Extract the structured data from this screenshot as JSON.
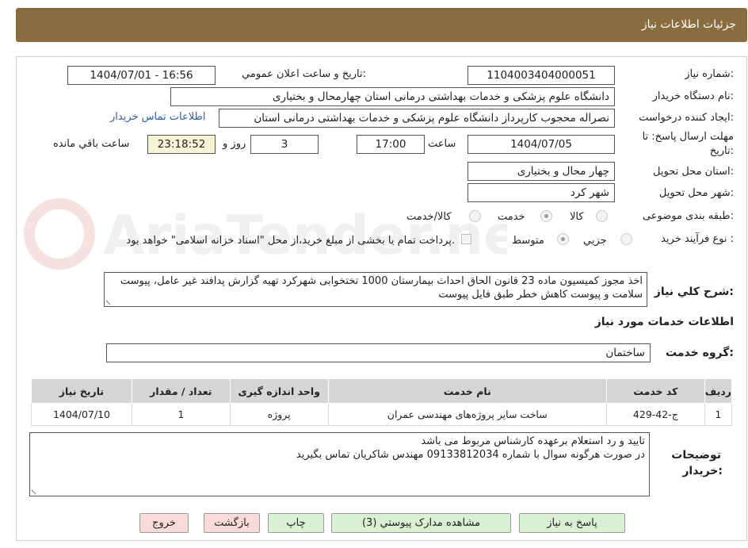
{
  "header": {
    "title": "جزئیات اطلاعات نیاز"
  },
  "watermark": {
    "text": "AriaTender.neT"
  },
  "form": {
    "need_number": {
      "label": "شماره نیاز:",
      "value": "1104003404000051"
    },
    "announce": {
      "label": "تاریخ و ساعت اعلان عمومي:",
      "value": "1404/07/01 - 16:56"
    },
    "buyer_org": {
      "label": "نام دستگاه خریدار:",
      "value": "دانشگاه علوم پزشکی و خدمات بهداشتی درمانی استان چهارمحال و بختیاری"
    },
    "requester": {
      "label": "ایجاد کننده درخواست:",
      "value": "نصراله محجوب کارپرداز دانشگاه علوم پزشکی و خدمات بهداشتی درمانی استان",
      "contact_link": "اطلاعات تماس خریدار"
    },
    "deadline": {
      "label_line1": "مهلت ارسال پاسخ: تا",
      "label_line2": "تاریخ:",
      "date": "1404/07/05",
      "time_label": "ساعت",
      "time": "17:00",
      "days": "3",
      "days_label": "روز و",
      "remaining": "23:18:52",
      "remaining_label": "ساعت باقي مانده"
    },
    "delivery_province": {
      "label": "استان محل تحویل:",
      "value": "چهار محال و بختیاری"
    },
    "delivery_city": {
      "label": "شهر محل تحویل:",
      "value": "شهر کرد"
    },
    "category": {
      "label": "طبقه بندی موضوعی:",
      "options": [
        "کالا",
        "خدمت",
        "کالا/خدمت"
      ],
      "selected": "خدمت"
    },
    "process": {
      "label": "نوع فرآیند خرید :",
      "options": [
        "جزيي",
        "متوسط"
      ],
      "selected": "متوسط",
      "payment_note": "پرداخت تمام یا بخشی از مبلغ خرید،از محل \"اسناد خزانه اسلامی\" خواهد بود."
    },
    "summary": {
      "label": "شرح کلي نیاز:",
      "value": "اخذ مجوز کمیسیون ماده 23 قانون الحاق احداث بیمارستان 1000 تختخوابی شهرکرد تهیه گزارش پدافند غیر عامل، پیوست سلامت و پیوست کاهش خطر طبق فایل پیوست"
    }
  },
  "services": {
    "section_title": "اطلاعات خدمات مورد نیاز",
    "group_label": "گروه خدمت:",
    "group_value": "ساختمان",
    "columns": [
      "ردیف",
      "کد خدمت",
      "نام خدمت",
      "واحد اندازه گیری",
      "تعداد / مقدار",
      "تاریخ نیاز"
    ],
    "rows": [
      [
        "1",
        "ج-42-429",
        "ساخت سایر پروژه‌های مهندسی عمران",
        "پروژه",
        "1",
        "1404/07/10"
      ]
    ]
  },
  "buyer_notes": {
    "label_line1": "توضیحات",
    "label_line2": "خریدار:",
    "line1": "تایید و رد استعلام برعهده کارشناس مربوط می باشد",
    "line2": "در صورت هرگونه سوال با شماره 09133812034 مهندس شاکریان تماس بگیرید"
  },
  "buttons": {
    "reply": "پاسخ به نیاز",
    "attachments": "مشاهده مدارک پیوستي (3)",
    "print": "چاپ",
    "back": "بازگشت",
    "exit": "خروج"
  }
}
